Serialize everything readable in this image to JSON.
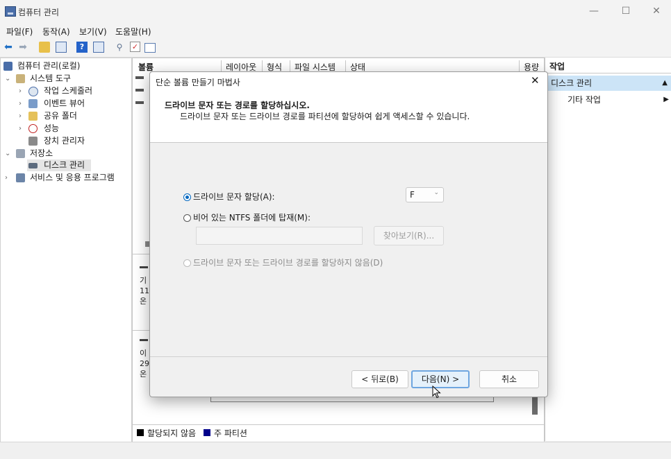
{
  "window": {
    "title": "컴퓨터 관리"
  },
  "caption_buttons": {
    "minimize": "—",
    "maximize": "☐",
    "close": "✕"
  },
  "menu": [
    "파일(F)",
    "동작(A)",
    "보기(V)",
    "도움말(H)"
  ],
  "tree": {
    "root": "컴퓨터 관리(로컬)",
    "system_tools": "시스템 도구",
    "task_scheduler": "작업 스케줄러",
    "event_viewer": "이벤트 뷰어",
    "shared_folders": "공유 폴더",
    "performance": "성능",
    "device_manager": "장치 관리자",
    "storage": "저장소",
    "disk_management": "디스크 관리",
    "services_apps": "서비스 및 응용 프로그램"
  },
  "volume_list": {
    "columns": [
      "볼륨",
      "레이아웃",
      "형식",
      "파일 시스템",
      "상태",
      "용량"
    ]
  },
  "disk_rows": {
    "row1": [
      "기",
      "11",
      "온"
    ],
    "row2": [
      "이",
      "29",
      "온"
    ]
  },
  "legend": {
    "unallocated": "할당되지 않음",
    "primary": "주 파티션",
    "unallocated_color": "#000000",
    "primary_color": "#00008b"
  },
  "actions": {
    "header": "작업",
    "section": "디스크 관리",
    "more": "기타 작업"
  },
  "dialog": {
    "title": "단순 볼륨 만들기 마법사",
    "heading": "드라이브 문자 또는 경로를 할당하십시오.",
    "subheading": "드라이브 문자 또는 드라이브 경로를 파티션에 할당하여 쉽게 액세스할 수 있습니다.",
    "option_assign": "드라이브 문자 할당(A):",
    "drive_letter": "F",
    "option_mount": "비어 있는 NTFS 폴더에 탑재(M):",
    "folder_path": "",
    "browse": "찾아보기(R)...",
    "option_none": "드라이브 문자 또는 드라이브 경로를 할당하지 않음(D)",
    "selected_option": "assign",
    "back": "< 뒤로(B)",
    "next": "다음(N) >",
    "cancel": "취소"
  }
}
